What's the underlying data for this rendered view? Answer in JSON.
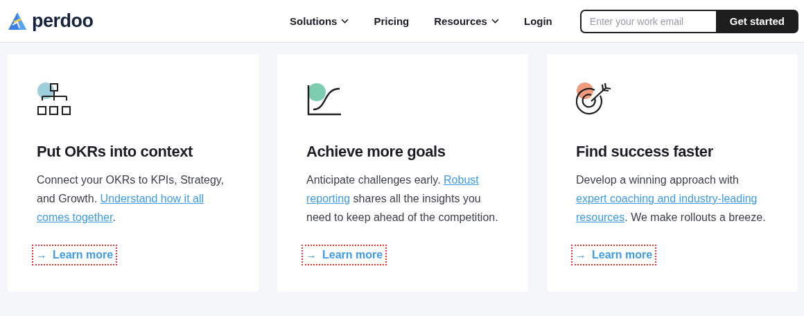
{
  "header": {
    "logo": "perdoo",
    "nav": [
      {
        "label": "Solutions",
        "dropdown": true
      },
      {
        "label": "Pricing",
        "dropdown": false
      },
      {
        "label": "Resources",
        "dropdown": true
      },
      {
        "label": "Login",
        "dropdown": false
      }
    ],
    "email_field": {
      "placeholder": "Enter your work email"
    },
    "cta": "Get started"
  },
  "cards": [
    {
      "kind": "org",
      "title": "Put OKRs into context",
      "lines": [
        [
          {
            "text": "Connect your OKRs to KPIs, Strategy,",
            "link": false
          }
        ],
        [
          {
            "text": "and Growth. ",
            "link": false
          },
          {
            "text": "Understand how it all",
            "link": true
          }
        ],
        [
          {
            "text": "comes together",
            "link": true
          },
          {
            "text": ".",
            "link": false
          }
        ]
      ],
      "action": {
        "arrow": "→",
        "label": "Learn more",
        "focused": true
      }
    },
    {
      "kind": "chart",
      "title": "Achieve more goals",
      "lines": [
        [
          {
            "text": "Anticipate challenges early. ",
            "link": false
          },
          {
            "text": "Robust",
            "link": true
          }
        ],
        [
          {
            "text": "reporting",
            "link": true
          },
          {
            "text": " shares all the insights you",
            "link": false
          }
        ],
        [
          {
            "text": "need to keep ahead of the competition.",
            "link": false
          }
        ]
      ],
      "action": {
        "arrow": "→",
        "label": "Learn more",
        "focused": true
      }
    },
    {
      "kind": "target",
      "title": "Find success faster",
      "lines": [
        [
          {
            "text": "Develop a winning approach with",
            "link": false
          }
        ],
        [
          {
            "text": "expert coaching and industry-leading",
            "link": true
          }
        ],
        [
          {
            "text": "resources",
            "link": true
          },
          {
            "text": ". We make rollouts a breeze.",
            "link": false
          }
        ]
      ],
      "action": {
        "arrow": "→",
        "label": "Learn more",
        "focused": true
      }
    }
  ]
}
